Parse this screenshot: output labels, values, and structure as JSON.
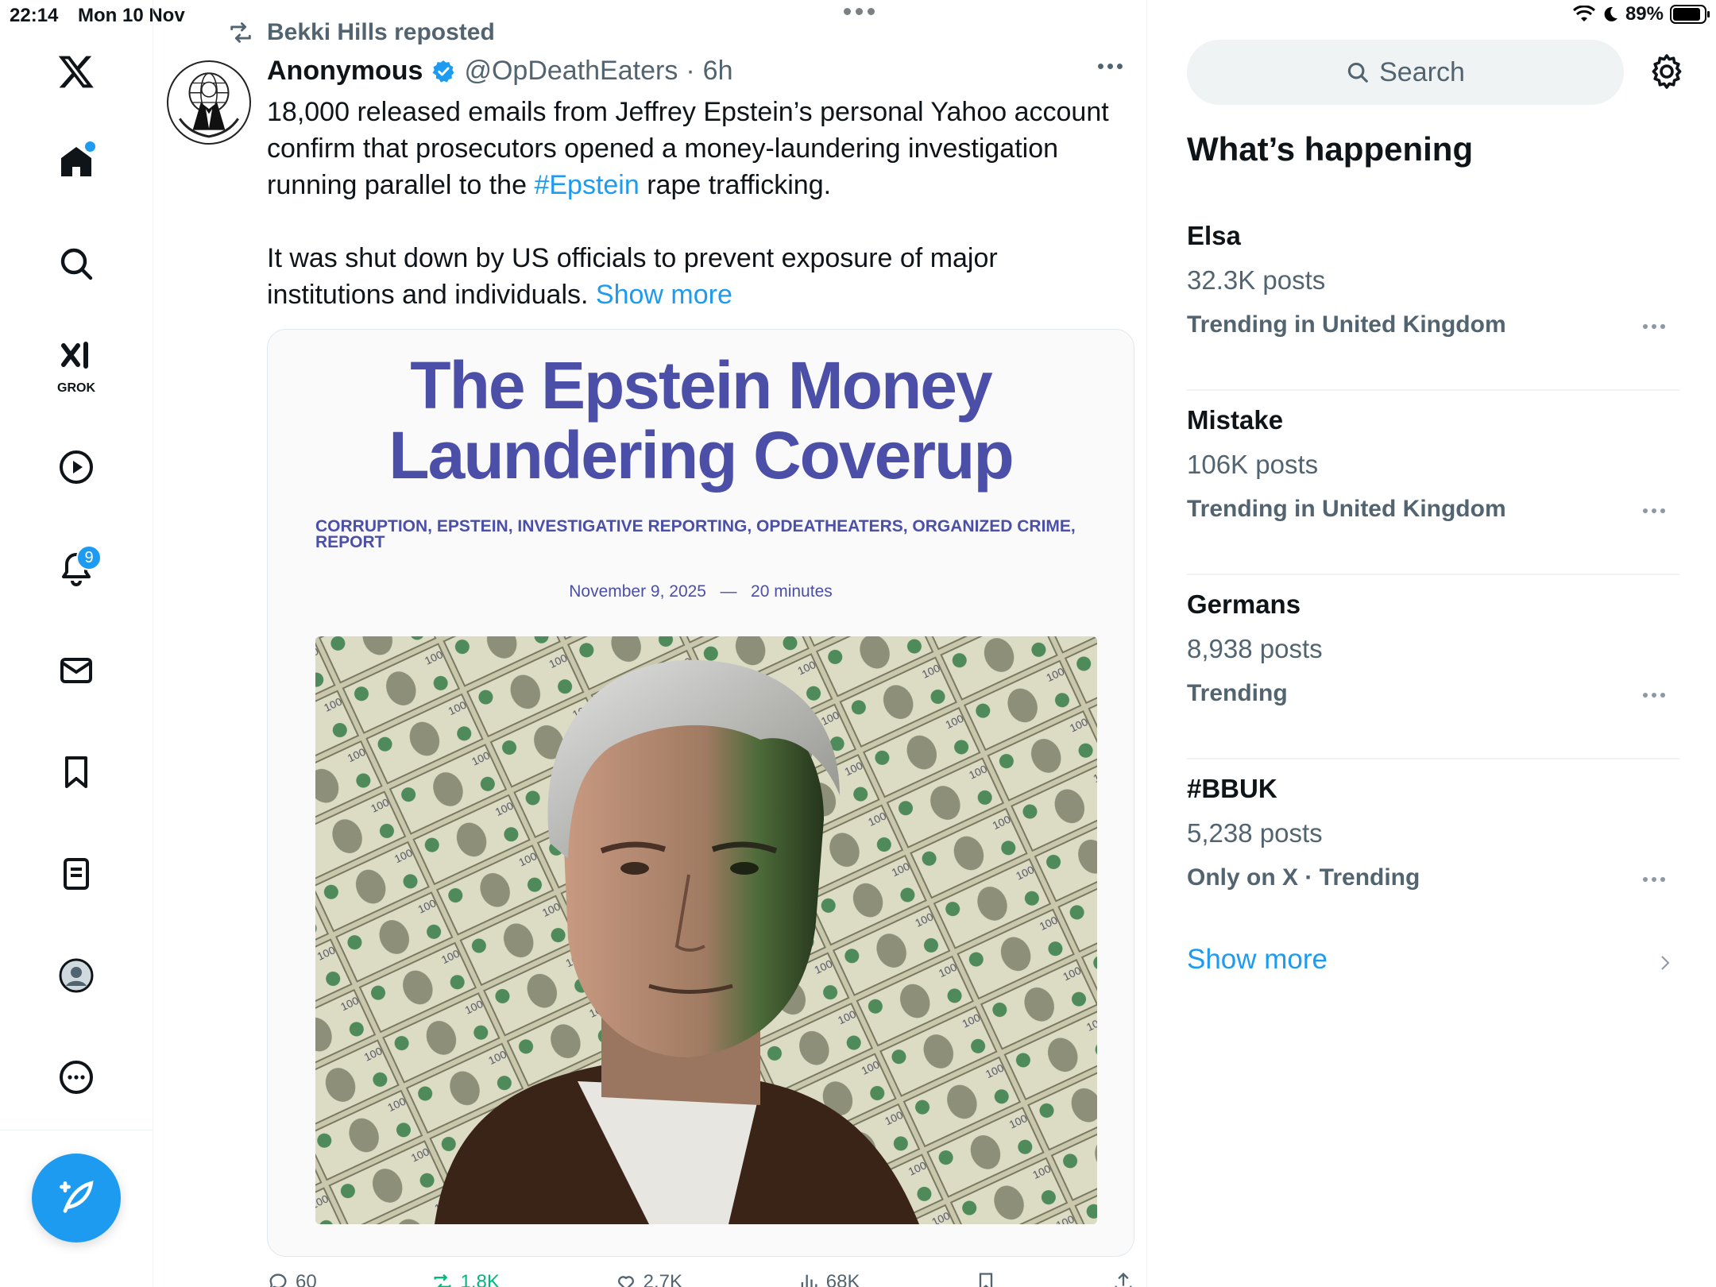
{
  "status_bar": {
    "time": "22:14",
    "date": "Mon 10 Nov",
    "battery": "89%",
    "battery_level": 0.89
  },
  "left_nav": {
    "logo_icon": "x-logo-icon",
    "items": [
      {
        "name": "home",
        "icon": "home-icon",
        "has_dot": true
      },
      {
        "name": "explore",
        "icon": "search-icon"
      },
      {
        "name": "grok",
        "icon": "grok-icon",
        "label": "GROK"
      },
      {
        "name": "video",
        "icon": "play-circle-icon"
      },
      {
        "name": "notifications",
        "icon": "bell-icon",
        "badge": "9"
      },
      {
        "name": "messages",
        "icon": "mail-icon"
      },
      {
        "name": "bookmarks",
        "icon": "bookmark-icon"
      },
      {
        "name": "articles",
        "icon": "article-icon"
      },
      {
        "name": "profile",
        "icon": "profile-icon"
      },
      {
        "name": "more",
        "icon": "more-circle-icon"
      }
    ],
    "compose_icon": "compose-icon"
  },
  "post": {
    "repost_label": "Bekki Hills reposted",
    "author_name": "Anonymous",
    "author_handle": "@OpDeathEaters",
    "time": "6h",
    "text_para1_before": "18,000 released emails from Jeffrey Epstein’s personal Yahoo account confirm that prosecutors opened a money-laundering investigation running parallel to the ",
    "hashtag": "#Epstein",
    "text_para1_after": " rape trafficking.",
    "text_para2": "It was shut down by US officials to prevent exposure of major institutions and individuals. ",
    "show_more": "Show more",
    "card": {
      "title_line1": "The Epstein Money",
      "title_line2": "Laundering Coverup",
      "tags": "CORRUPTION, EPSTEIN, INVESTIGATIVE REPORTING, OPDEATHEATERS, ORGANIZED CRIME, REPORT",
      "date": "November 9, 2025",
      "separator": "—",
      "read_time": "20 minutes"
    },
    "actions": {
      "replies": "60",
      "reposts": "1.8K",
      "likes": "2.7K",
      "views": "68K"
    }
  },
  "sidebar": {
    "search_placeholder": "Search",
    "section_title": "What’s happening",
    "trends": [
      {
        "name": "Elsa",
        "count": "32.3K posts",
        "context": "Trending in United Kingdom"
      },
      {
        "name": "Mistake",
        "count": "106K posts",
        "context": "Trending in United Kingdom"
      },
      {
        "name": "Germans",
        "count": "8,938 posts",
        "context": "Trending"
      },
      {
        "name": "#BBUK",
        "count": "5,238 posts",
        "context": "Only on X · Trending"
      }
    ],
    "show_more": "Show more"
  },
  "colors": {
    "accent": "#1d9bf0",
    "card_title": "#4b4fa8",
    "secondary_text": "#536471",
    "repost_green": "#00ba7c"
  }
}
